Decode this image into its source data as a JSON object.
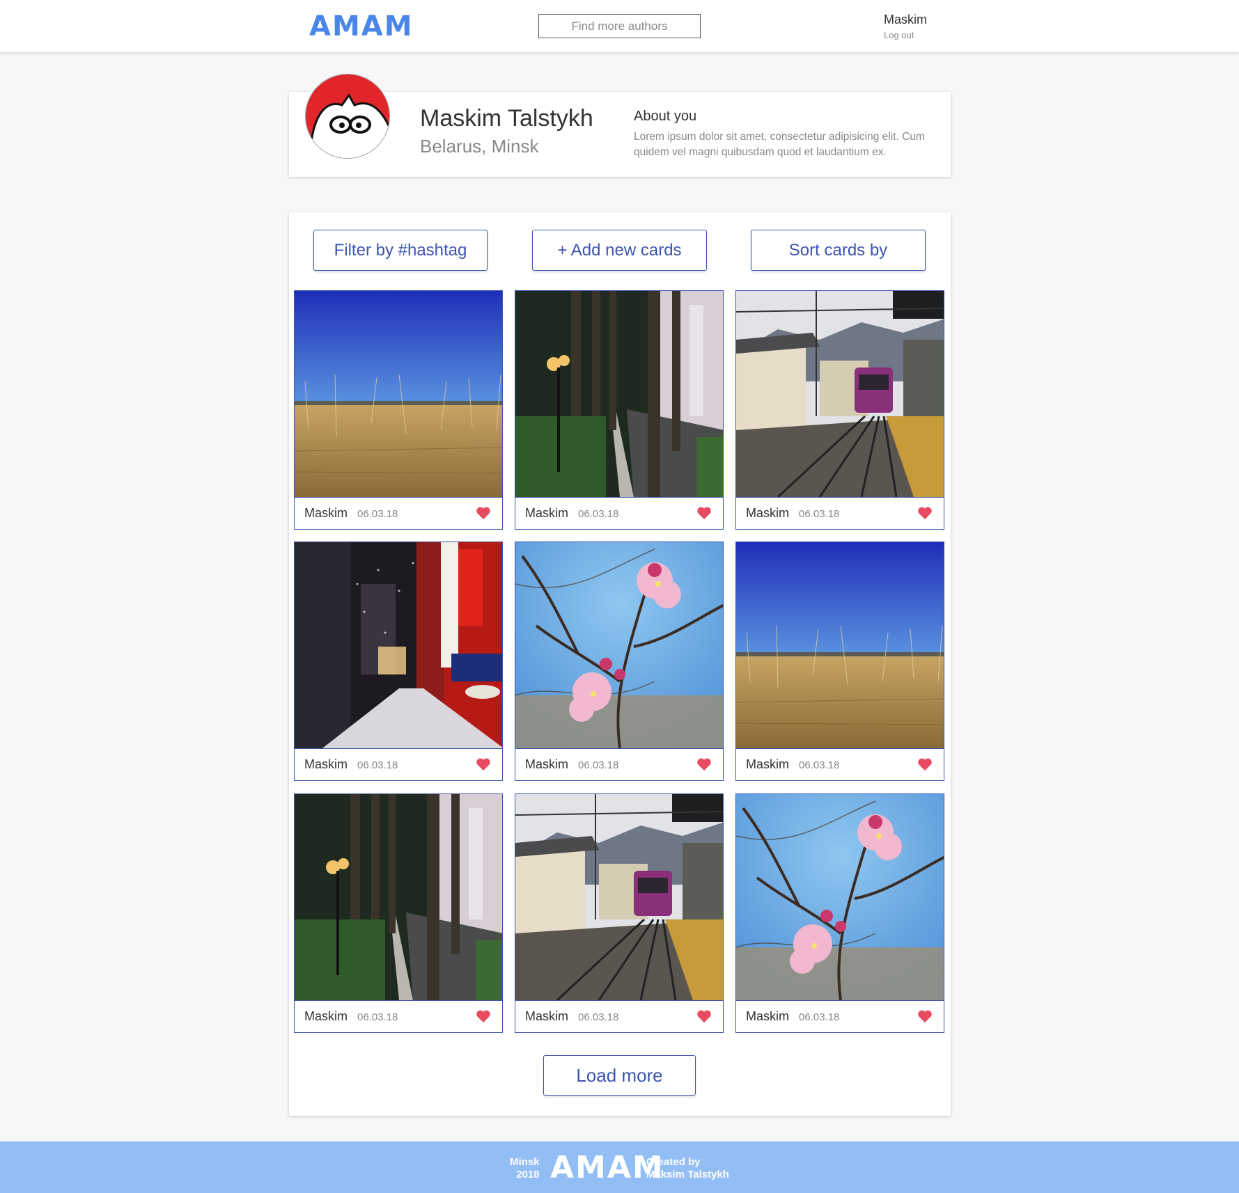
{
  "header": {
    "logo": "AMAM",
    "search_placeholder": "Find more authors",
    "user_name": "Maskim",
    "logout_label": "Log out"
  },
  "profile": {
    "name": "Maskim Talstykh",
    "location": "Belarus, Minsk",
    "about_title": "About you",
    "about_text": "Lorem ipsum dolor sit amet, consectetur adipisicing elit. Cum quidem vel magni quibusdam quod et laudantium ex."
  },
  "actions": {
    "filter_label": "Filter by #hashtag",
    "add_label": "+ Add new cards",
    "sort_label": "Sort cards by",
    "load_more_label": "Load more"
  },
  "cards": [
    {
      "author": "Maskim",
      "date": "06.03.18",
      "photo": "wheat-field",
      "liked": true
    },
    {
      "author": "Maskim",
      "date": "06.03.18",
      "photo": "palm-street",
      "liked": true
    },
    {
      "author": "Maskim",
      "date": "06.03.18",
      "photo": "tram-station",
      "liked": true
    },
    {
      "author": "Maskim",
      "date": "06.03.18",
      "photo": "night-city-snow",
      "liked": true
    },
    {
      "author": "Maskim",
      "date": "06.03.18",
      "photo": "cherry-blossom",
      "liked": true
    },
    {
      "author": "Maskim",
      "date": "06.03.18",
      "photo": "wheat-field",
      "liked": true
    },
    {
      "author": "Maskim",
      "date": "06.03.18",
      "photo": "palm-street",
      "liked": true
    },
    {
      "author": "Maskim",
      "date": "06.03.18",
      "photo": "tram-station",
      "liked": true
    },
    {
      "author": "Maskim",
      "date": "06.03.18",
      "photo": "cherry-blossom",
      "liked": true
    }
  ],
  "footer": {
    "city": "Minsk",
    "year": "2018",
    "logo": "AMAM",
    "created_by": "Created by",
    "author": "Maksim Talstykh"
  },
  "colors": {
    "accent": "#3d55b0",
    "logo": "#4a86e8",
    "footer": "#93bdf5",
    "heart": "#e84a5f"
  }
}
